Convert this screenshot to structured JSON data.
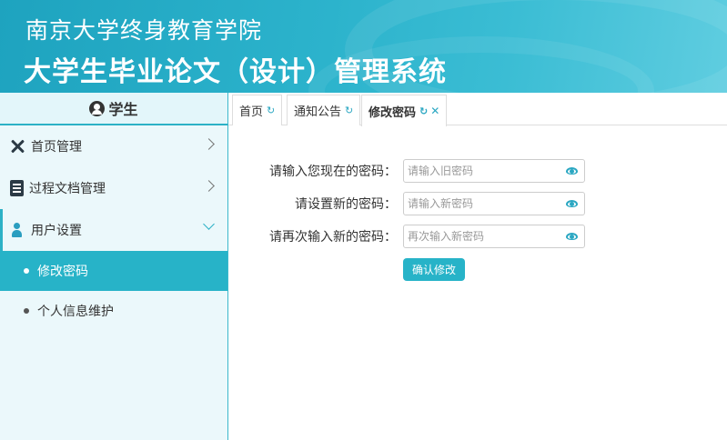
{
  "header": {
    "school_name": "南京大学终身教育学院",
    "system_name": "大学生毕业论文（设计）管理系统"
  },
  "sidebar": {
    "role": "学生",
    "items": [
      {
        "label": "首页管理"
      },
      {
        "label": "过程文档管理"
      },
      {
        "label": "用户设置"
      }
    ],
    "sub_items": [
      {
        "label": "修改密码",
        "active": true
      },
      {
        "label": "个人信息维护",
        "active": false
      }
    ]
  },
  "tabs": [
    {
      "label": "首页"
    },
    {
      "label": "通知公告"
    },
    {
      "label": "修改密码",
      "active": true
    }
  ],
  "form": {
    "old_password_label": "请输入您现在的密码：",
    "old_password_placeholder": "请输入旧密码",
    "new_password_label": "请设置新的密码：",
    "new_password_placeholder": "请输入新密码",
    "confirm_password_label": "请再次输入新的密码：",
    "confirm_password_placeholder": "再次输入新密码",
    "submit_label": "确认修改"
  },
  "colors": {
    "accent": "#27b3c8",
    "header_start": "#1ea3bf",
    "sidebar_bg": "#ebf8fb"
  }
}
